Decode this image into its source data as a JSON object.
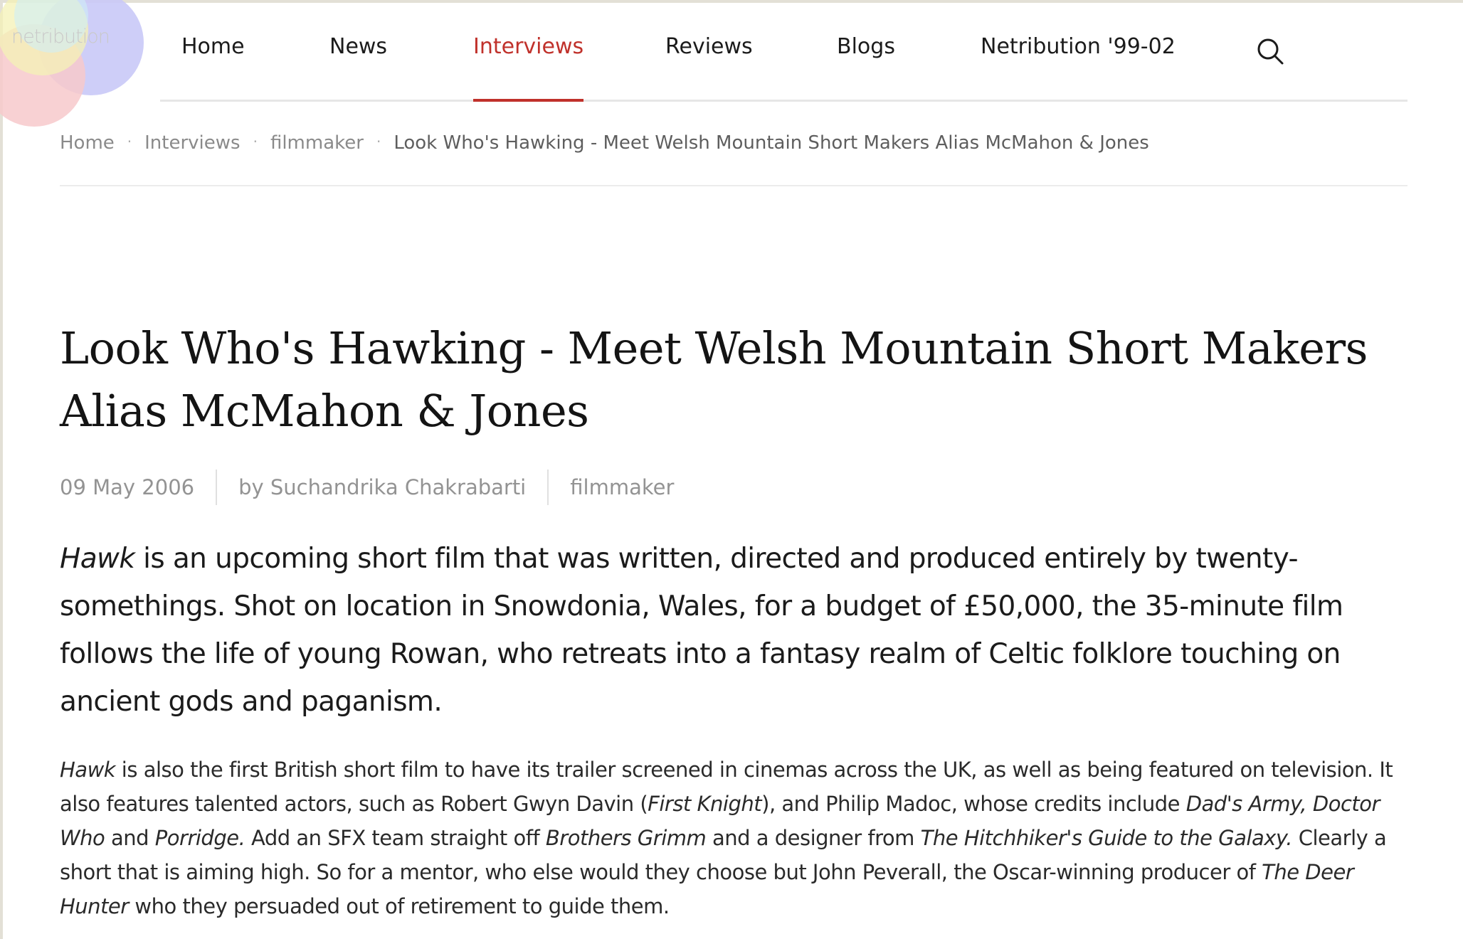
{
  "site": {
    "logo_text": "netribution"
  },
  "nav": {
    "items": [
      "Home",
      "News",
      "Interviews",
      "Reviews",
      "Blogs",
      "Netribution '99-02"
    ],
    "active_index": 2,
    "search_icon": "search-icon"
  },
  "breadcrumb": {
    "items": [
      "Home",
      "Interviews",
      "filmmaker"
    ],
    "current": "Look Who's Hawking - Meet Welsh Mountain Short Makers Alias McMahon & Jones",
    "separator": "·"
  },
  "article": {
    "title": "Look Who's Hawking - Meet Welsh Mountain Short Makers Alias McMahon & Jones",
    "date": "09 May 2006",
    "author": "by Suchandrika Chakrabarti",
    "tag": "filmmaker",
    "lead": {
      "film": "Hawk",
      "text": " is an upcoming short film that was written, directed and produced entirely by twenty-somethings. Shot on location in Snowdonia, Wales, for a budget of £50,000, the 35-minute film follows the life of young Rowan, who retreats into a fantasy realm of Celtic folklore touching on ancient gods and paganism."
    },
    "body": {
      "t1": "Hawk",
      "t2": " is also the first British short film to have its trailer screened in cinemas across the UK, as well as being featured on television. It also features talented actors, such as Robert Gwyn Davin (",
      "t3": "First Knight",
      "t4": "), and Philip Madoc, whose credits include ",
      "t5": "Dad's Army, Doctor Who",
      "t6": " and ",
      "t7": "Porridge.",
      "t8": " Add an SFX team straight off ",
      "t9": "Brothers Grimm",
      "t10": " and a designer from ",
      "t11": "The Hitchhiker's Guide to the Galaxy.",
      "t12": " Clearly a short that is aiming high. So for a mentor, who else would they choose but John Peverall, the Oscar-winning producer of ",
      "t13": "The Deer Hunter",
      "t14": " who they persuaded out of retirement to guide them."
    }
  },
  "colors": {
    "accent": "#c0312b",
    "text": "#1b1b1b",
    "muted": "#8a8a8a",
    "logo_circles": [
      "#c9c9f7",
      "#f7c9cb",
      "#f4f2b5",
      "#cfeef7"
    ]
  }
}
